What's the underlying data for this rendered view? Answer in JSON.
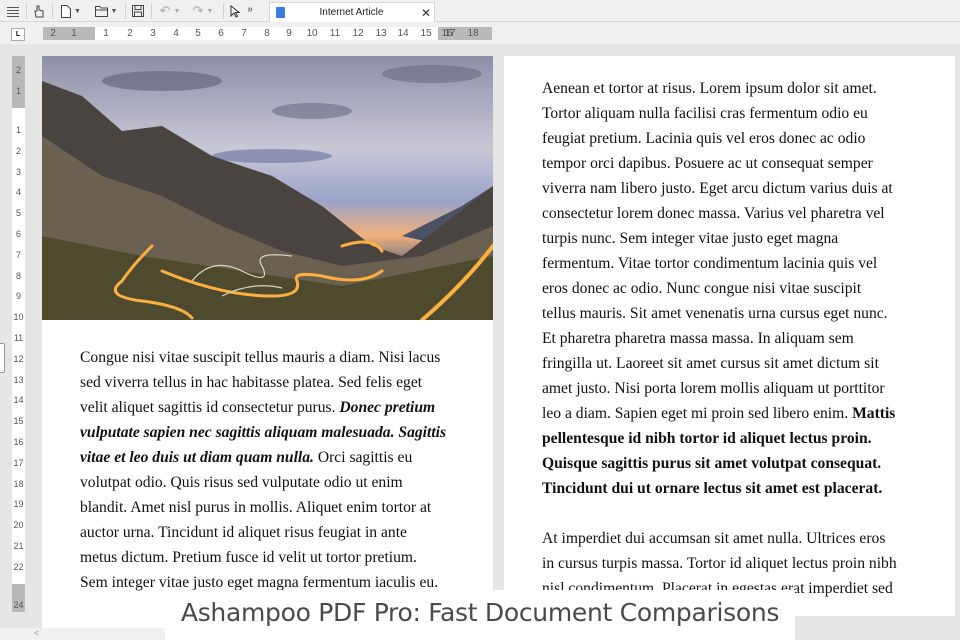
{
  "toolbar": {
    "menu_icon": "hamburger-icon",
    "hand_icon": "hand-tool-icon",
    "new_icon": "new-document-icon",
    "open_icon": "open-folder-icon",
    "save_icon": "save-icon",
    "undo_icon": "undo-icon",
    "redo_icon": "redo-icon",
    "select_icon": "select-arrow-icon",
    "more": "»"
  },
  "tab": {
    "title": "Internet Article",
    "close": "✕"
  },
  "ruler": {
    "corner": "L",
    "h_labels": [
      "2",
      "1",
      "1",
      "2",
      "3",
      "4",
      "5",
      "6",
      "7",
      "8",
      "9",
      "10",
      "11",
      "12",
      "13",
      "14",
      "15",
      "16",
      "17",
      "18"
    ],
    "v_labels": [
      "2",
      "1",
      "1",
      "2",
      "3",
      "4",
      "5",
      "6",
      "7",
      "8",
      "9",
      "10",
      "11",
      "12",
      "13",
      "14",
      "15",
      "16",
      "17",
      "18",
      "19",
      "20",
      "21",
      "22",
      "24"
    ]
  },
  "page1": {
    "lines": [
      [
        {
          "t": "Congue nisi vitae suscipit tellus mauris a diam. Nisi lacus",
          "s": "n"
        }
      ],
      [
        {
          "t": "sed viverra tellus in hac habitasse platea. Sed felis eget",
          "s": "n"
        }
      ],
      [
        {
          "t": "velit aliquet sagittis id consectetur purus. ",
          "s": "n"
        },
        {
          "t": "Donec pretium",
          "s": "bi"
        }
      ],
      [
        {
          "t": "vulputate sapien nec sagittis aliquam malesuada. Sagittis",
          "s": "bi"
        }
      ],
      [
        {
          "t": "vitae et leo duis ut diam quam nulla.",
          "s": "bi"
        },
        {
          "t": " Orci sagittis eu",
          "s": "n"
        }
      ],
      [
        {
          "t": "volutpat odio. Quis risus sed vulputate odio ut enim",
          "s": "n"
        }
      ],
      [
        {
          "t": "blandit. Amet nisl purus in mollis. Aliquet enim tortor at",
          "s": "n"
        }
      ],
      [
        {
          "t": "auctor urna. Tincidunt id aliquet risus feugiat in ante",
          "s": "n"
        }
      ],
      [
        {
          "t": "metus dictum. Pretium fusce id velit ut tortor pretium.",
          "s": "n"
        }
      ],
      [
        {
          "t": "Sem integer vitae justo eget magna fermentum iaculis eu.",
          "s": "n"
        }
      ]
    ]
  },
  "page2": {
    "lines": [
      [
        {
          "t": "Aenean et tortor at risus. Lorem ipsum dolor sit amet.",
          "s": "n"
        }
      ],
      [
        {
          "t": "Tortor aliquam nulla facilisi cras fermentum odio eu",
          "s": "n"
        }
      ],
      [
        {
          "t": "feugiat pretium. Lacinia quis vel eros donec ac odio",
          "s": "n"
        }
      ],
      [
        {
          "t": "tempor orci dapibus. Posuere ac ut consequat semper",
          "s": "n"
        }
      ],
      [
        {
          "t": "viverra nam libero justo. Eget arcu dictum varius duis at",
          "s": "n"
        }
      ],
      [
        {
          "t": "consectetur lorem donec massa. Varius vel pharetra vel",
          "s": "n"
        }
      ],
      [
        {
          "t": "turpis nunc. Sem integer vitae justo eget magna",
          "s": "n"
        }
      ],
      [
        {
          "t": "fermentum. Vitae tortor condimentum lacinia quis vel",
          "s": "n"
        }
      ],
      [
        {
          "t": "eros donec ac odio. Nunc congue nisi vitae suscipit",
          "s": "n"
        }
      ],
      [
        {
          "t": "tellus mauris. Sit amet venenatis urna cursus eget nunc.",
          "s": "n"
        }
      ],
      [
        {
          "t": "Et pharetra pharetra massa massa. In aliquam sem",
          "s": "n"
        }
      ],
      [
        {
          "t": "fringilla ut. Laoreet sit amet cursus sit amet dictum sit",
          "s": "n"
        }
      ],
      [
        {
          "t": "amet justo. Nisi porta lorem mollis aliquam ut porttitor",
          "s": "n"
        }
      ],
      [
        {
          "t": "leo a diam. Sapien eget mi proin sed libero enim. ",
          "s": "n"
        },
        {
          "t": "Mattis",
          "s": "b"
        }
      ],
      [
        {
          "t": "pellentesque id nibh tortor id aliquet lectus proin.",
          "s": "b"
        }
      ],
      [
        {
          "t": "Quisque sagittis purus sit amet volutpat consequat.",
          "s": "b"
        }
      ],
      [
        {
          "t": "Tincidunt dui ut ornare lectus sit amet est placerat.",
          "s": "b"
        }
      ],
      [
        {
          "t": "",
          "s": "n"
        }
      ],
      [
        {
          "t": "At imperdiet dui accumsan sit amet nulla. Ultrices eros",
          "s": "n"
        }
      ],
      [
        {
          "t": "in cursus turpis massa. Tortor id aliquet lectus proin nibh",
          "s": "n"
        }
      ],
      [
        {
          "t": "nisl condimentum. Placerat in egestas erat imperdiet sed",
          "s": "n"
        }
      ]
    ]
  },
  "caption": "Ashampoo PDF Pro: Fast Document Comparisons",
  "scroll": {
    "left_arrow": "<"
  }
}
